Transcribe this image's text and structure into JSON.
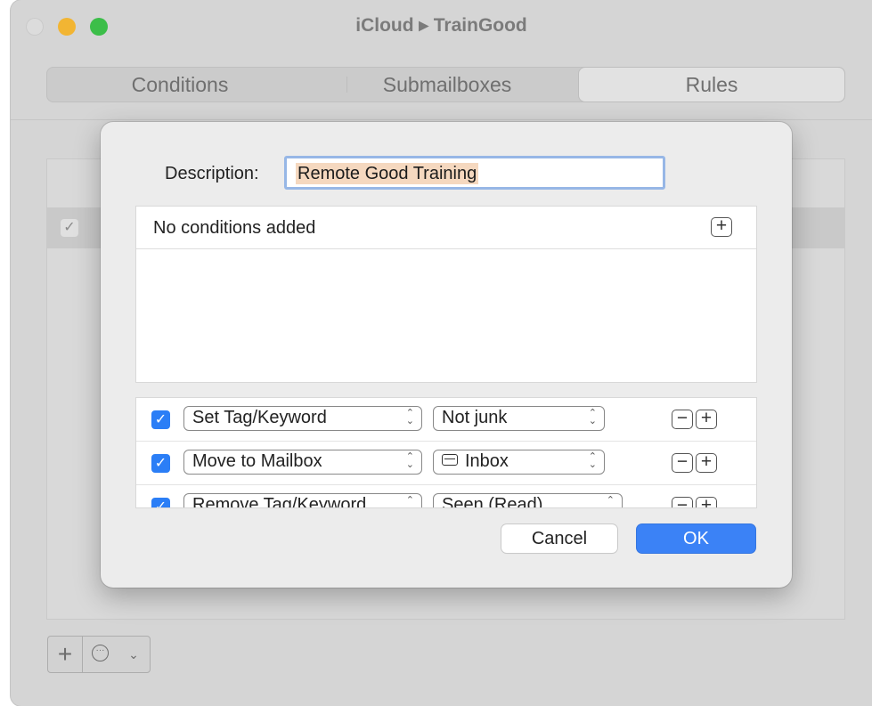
{
  "window": {
    "title": "iCloud ▸ TrainGood"
  },
  "tabs": [
    {
      "label": "Conditions"
    },
    {
      "label": "Submailboxes"
    },
    {
      "label": "Rules",
      "selected": true
    }
  ],
  "background_list": {
    "rows": [
      {
        "checked": true
      }
    ]
  },
  "bottom_bar": {
    "add_icon": "+",
    "more_icon": "ellipsis-circle-icon",
    "menu_icon": "chevron-down-icon"
  },
  "sheet": {
    "description_label": "Description:",
    "description_value": "Remote Good Training",
    "conditions_empty_text": "No conditions added",
    "actions": [
      {
        "checked": true,
        "action": "Set Tag/Keyword",
        "value": "Not junk",
        "value_icon": null
      },
      {
        "checked": true,
        "action": "Move to Mailbox",
        "value": "Inbox",
        "value_icon": "inbox-tray-icon"
      },
      {
        "checked": true,
        "action": "Remove Tag/Keyword",
        "value": "Seen (Read)",
        "value_icon": null
      }
    ],
    "cancel_label": "Cancel",
    "ok_label": "OK"
  },
  "colors": {
    "accent": "#3b82f6",
    "selection_highlight": "#f5d8bf",
    "focus_ring": "#97b7e6"
  }
}
